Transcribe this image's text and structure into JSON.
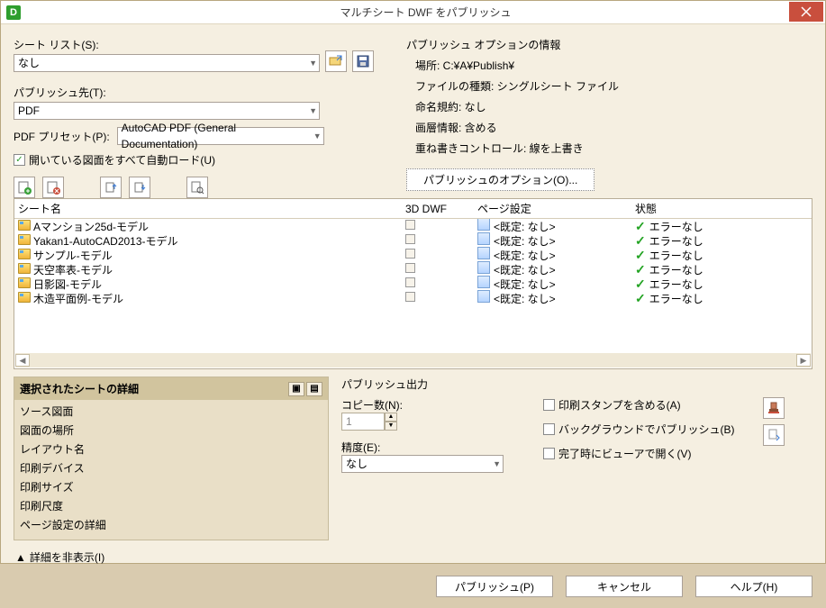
{
  "title": "マルチシート DWF をパブリッシュ",
  "left": {
    "sheetlist_label": "シート リスト(S):",
    "sheetlist_value": "なし",
    "publishto_label": "パブリッシュ先(T):",
    "publishto_value": "PDF",
    "pdfpreset_label": "PDF プリセット(P):",
    "pdfpreset_value": "AutoCAD PDF (General Documentation)",
    "autoload_label": "開いている図面をすべて自動ロード(U)"
  },
  "info": {
    "heading": "パブリッシュ オプションの情報",
    "loc_label": "場所: ",
    "loc_value": "C:¥A¥Publish¥",
    "type_label": "ファイルの種類: ",
    "type_value": "シングルシート ファイル",
    "name_label": "命名規約: ",
    "name_value": "なし",
    "layer_label": "画層情報: ",
    "layer_value": "含める",
    "merge_label": "重ね書きコントロール: ",
    "merge_value": "線を上書き",
    "opt_button": "パブリッシュのオプション(O)..."
  },
  "columns": {
    "name": "シート名",
    "threed": "3D DWF",
    "page": "ページ設定",
    "state": "状態"
  },
  "sheets": [
    {
      "name": "Aマンション25d-モデル",
      "page": "<既定: なし>",
      "state": "エラーなし"
    },
    {
      "name": "Yakan1-AutoCAD2013-モデル",
      "page": "<既定: なし>",
      "state": "エラーなし"
    },
    {
      "name": "サンプル-モデル",
      "page": "<既定: なし>",
      "state": "エラーなし"
    },
    {
      "name": "天空率表-モデル",
      "page": "<既定: なし>",
      "state": "エラーなし"
    },
    {
      "name": "日影図-モデル",
      "page": "<既定: なし>",
      "state": "エラーなし"
    },
    {
      "name": "木造平面例-モデル",
      "page": "<既定: なし>",
      "state": "エラーなし"
    }
  ],
  "detail": {
    "heading": "選択されたシートの詳細",
    "rows": [
      "ソース図面",
      "図面の場所",
      "レイアウト名",
      "印刷デバイス",
      "印刷サイズ",
      "印刷尺度",
      "ページ設定の詳細"
    ]
  },
  "output": {
    "heading": "パブリッシュ出力",
    "copies_label": "コピー数(N):",
    "copies_value": "1",
    "precision_label": "精度(E):",
    "precision_value": "なし",
    "stamp_label": "印刷スタンプを含める(A)",
    "background_label": "バックグラウンドでパブリッシュ(B)",
    "viewer_label": "完了時にビューアで開く(V)"
  },
  "hide_detail": "詳細を非表示(I)",
  "buttons": {
    "publish": "パブリッシュ(P)",
    "cancel": "キャンセル",
    "help": "ヘルプ(H)"
  }
}
